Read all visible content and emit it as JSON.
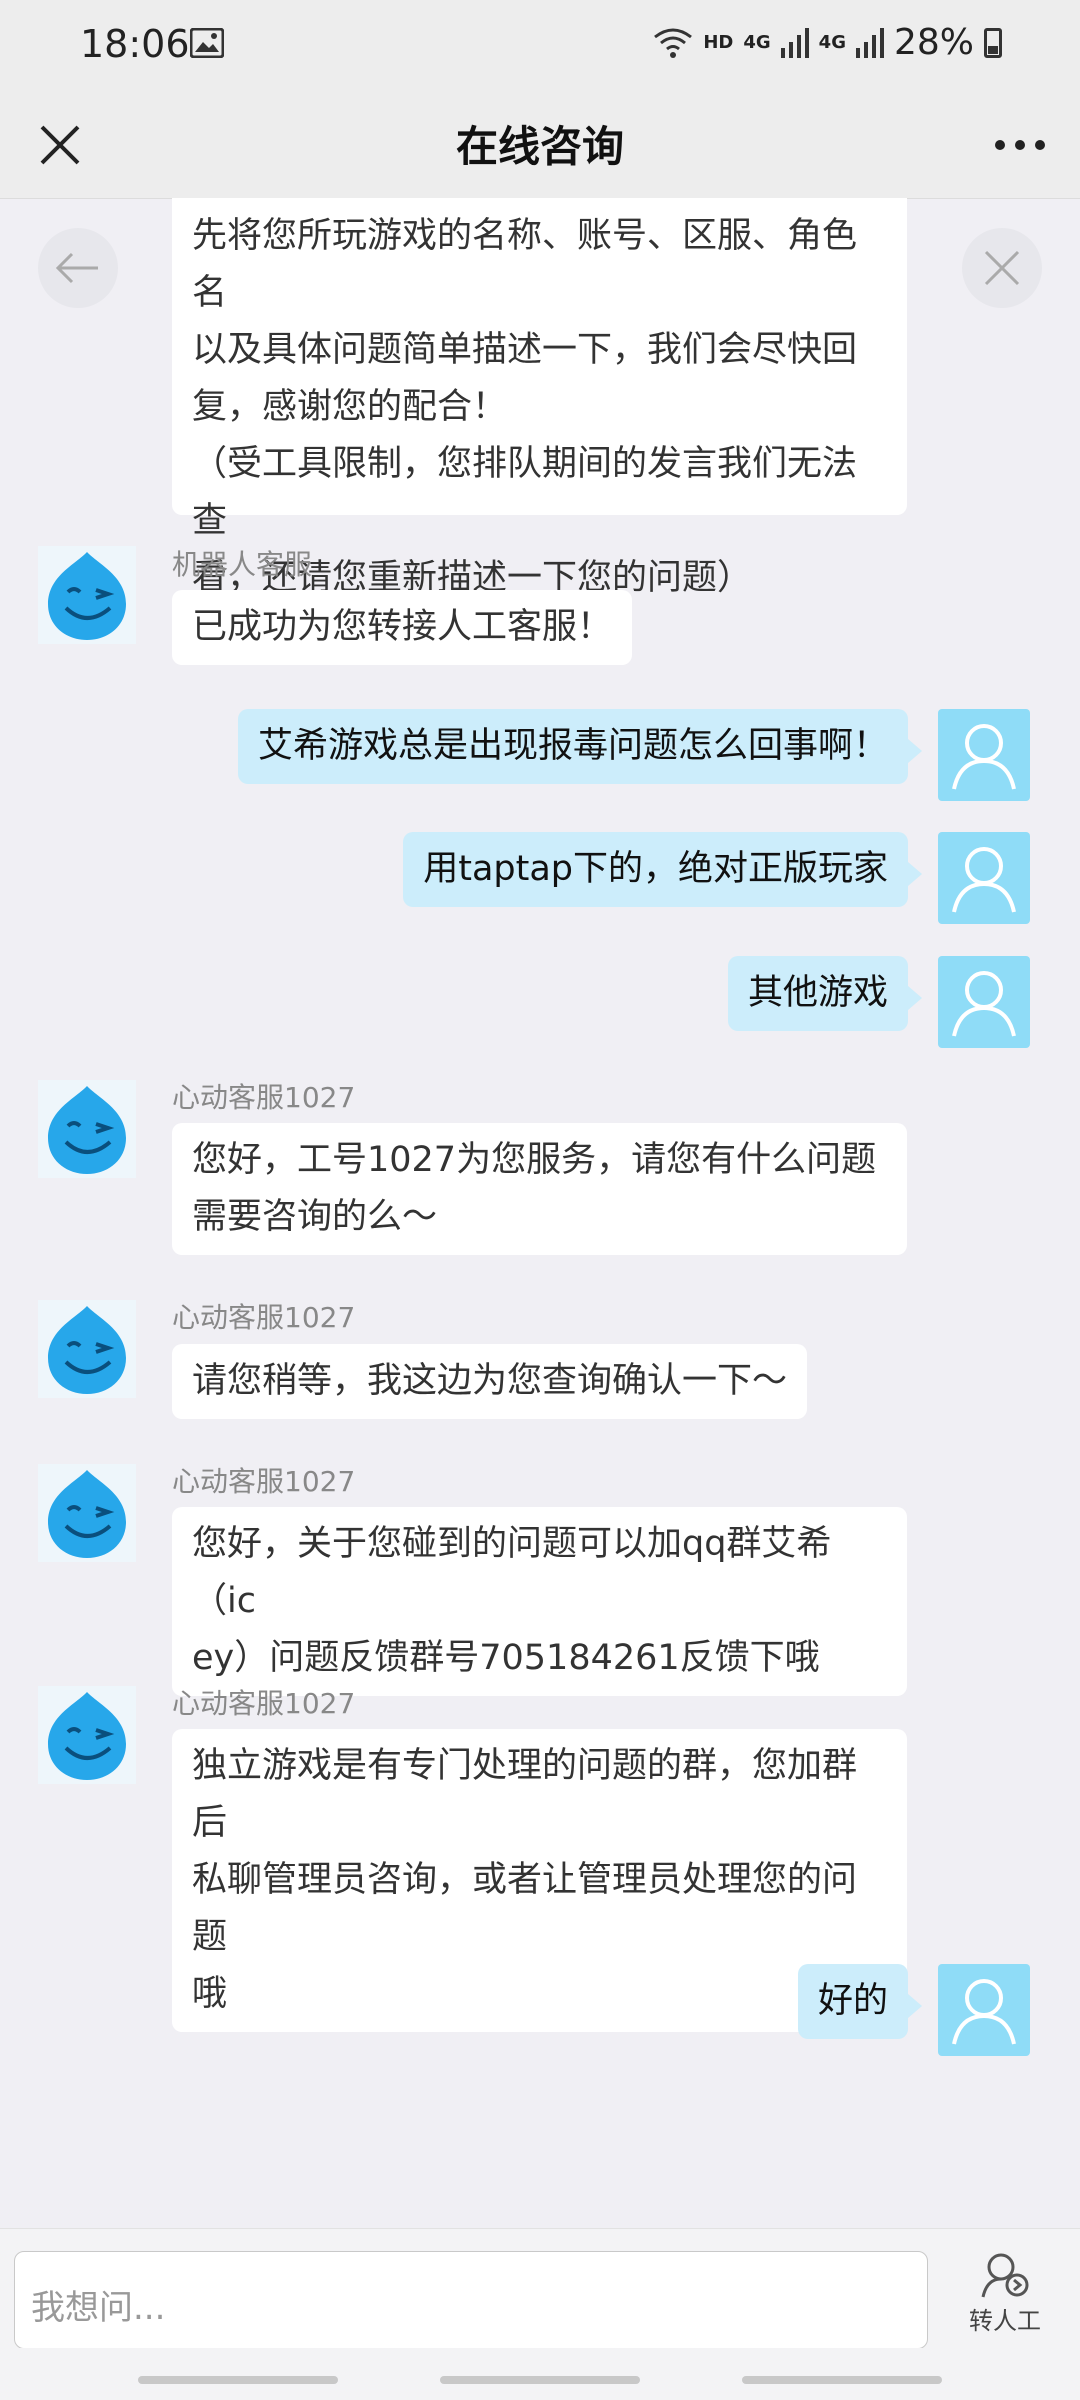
{
  "status_bar": {
    "time": "18:06",
    "network_label": "HD",
    "signal_label_1": "4G",
    "signal_label_2": "4G",
    "battery": "28%"
  },
  "header": {
    "title": "在线咨询"
  },
  "messages": [
    {
      "side": "left",
      "sender": "",
      "lines": [
        "先将您所玩游戏的名称、账号、区服、角色名",
        "以及具体问题简单描述一下，我们会尽快回",
        "复，感谢您的配合！",
        "（受工具限制，您排队期间的发言我们无法查",
        "看，还请您重新描述一下您的问题）"
      ]
    },
    {
      "side": "left",
      "sender": "机器人客服",
      "lines": [
        "已成功为您转接人工客服！"
      ]
    },
    {
      "side": "right",
      "lines": [
        "艾希游戏总是出现报毒问题怎么回事啊！"
      ]
    },
    {
      "side": "right",
      "lines": [
        "用taptap下的，绝对正版玩家"
      ]
    },
    {
      "side": "right",
      "lines": [
        "其他游戏"
      ]
    },
    {
      "side": "left",
      "sender": "心动客服1027",
      "lines": [
        "您好，工号1027为您服务，请您有什么问题",
        "需要咨询的么～"
      ]
    },
    {
      "side": "left",
      "sender": "心动客服1027",
      "lines": [
        "请您稍等，我这边为您查询确认一下～"
      ]
    },
    {
      "side": "left",
      "sender": "心动客服1027",
      "lines": [
        "您好，关于您碰到的问题可以加qq群艾希（ic",
        "ey）问题反馈群号705184261反馈下哦"
      ]
    },
    {
      "side": "left",
      "sender": "心动客服1027",
      "lines": [
        "独立游戏是有专门处理的问题的群，您加群后",
        "私聊管理员咨询，或者让管理员处理您的问题",
        "哦"
      ]
    },
    {
      "side": "right",
      "lines": [
        "好的"
      ]
    }
  ],
  "input": {
    "placeholder": "我想问...",
    "transfer_label": "转人工"
  },
  "colors": {
    "user_bubble": "#ccedfb",
    "user_avatar": "#8fdcf7",
    "background": "#f0eff4"
  }
}
